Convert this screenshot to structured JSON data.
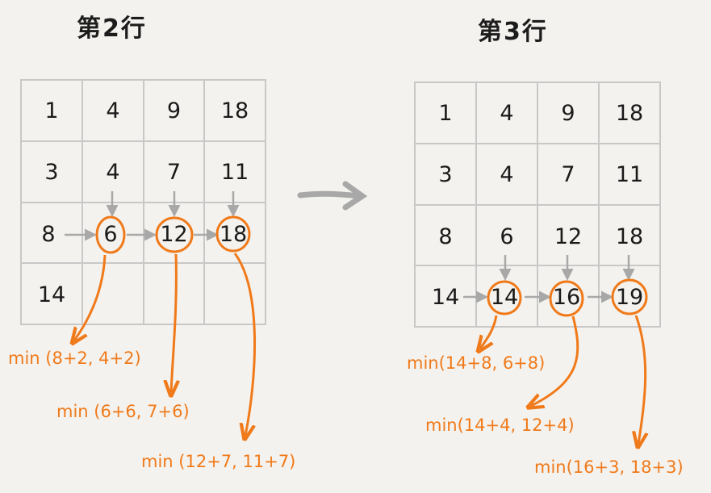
{
  "left": {
    "title": "第2行",
    "grid": [
      [
        "1",
        "4",
        "9",
        "18"
      ],
      [
        "3",
        "4",
        "7",
        "11"
      ],
      [
        "8",
        "6",
        "12",
        "18"
      ],
      [
        "14",
        "",
        "",
        ""
      ]
    ],
    "formulas": [
      "min (8+2, 4+2)",
      "min (6+6, 7+6)",
      "min (12+7, 11+7)"
    ]
  },
  "right": {
    "title": "第3行",
    "grid": [
      [
        "1",
        "4",
        "9",
        "18"
      ],
      [
        "3",
        "4",
        "7",
        "11"
      ],
      [
        "8",
        "6",
        "12",
        "18"
      ],
      [
        "14",
        "14",
        "16",
        "19"
      ]
    ],
    "formulas": [
      "min(14+8, 6+8)",
      "min(14+4, 12+4)",
      "min(16+3, 18+3)"
    ]
  },
  "colors": {
    "highlight": "#f07a1a",
    "grid_line": "#c8c8c8",
    "arrow": "#a8a8a8",
    "text": "#1a1a1a",
    "background": "#f4f2ee"
  }
}
